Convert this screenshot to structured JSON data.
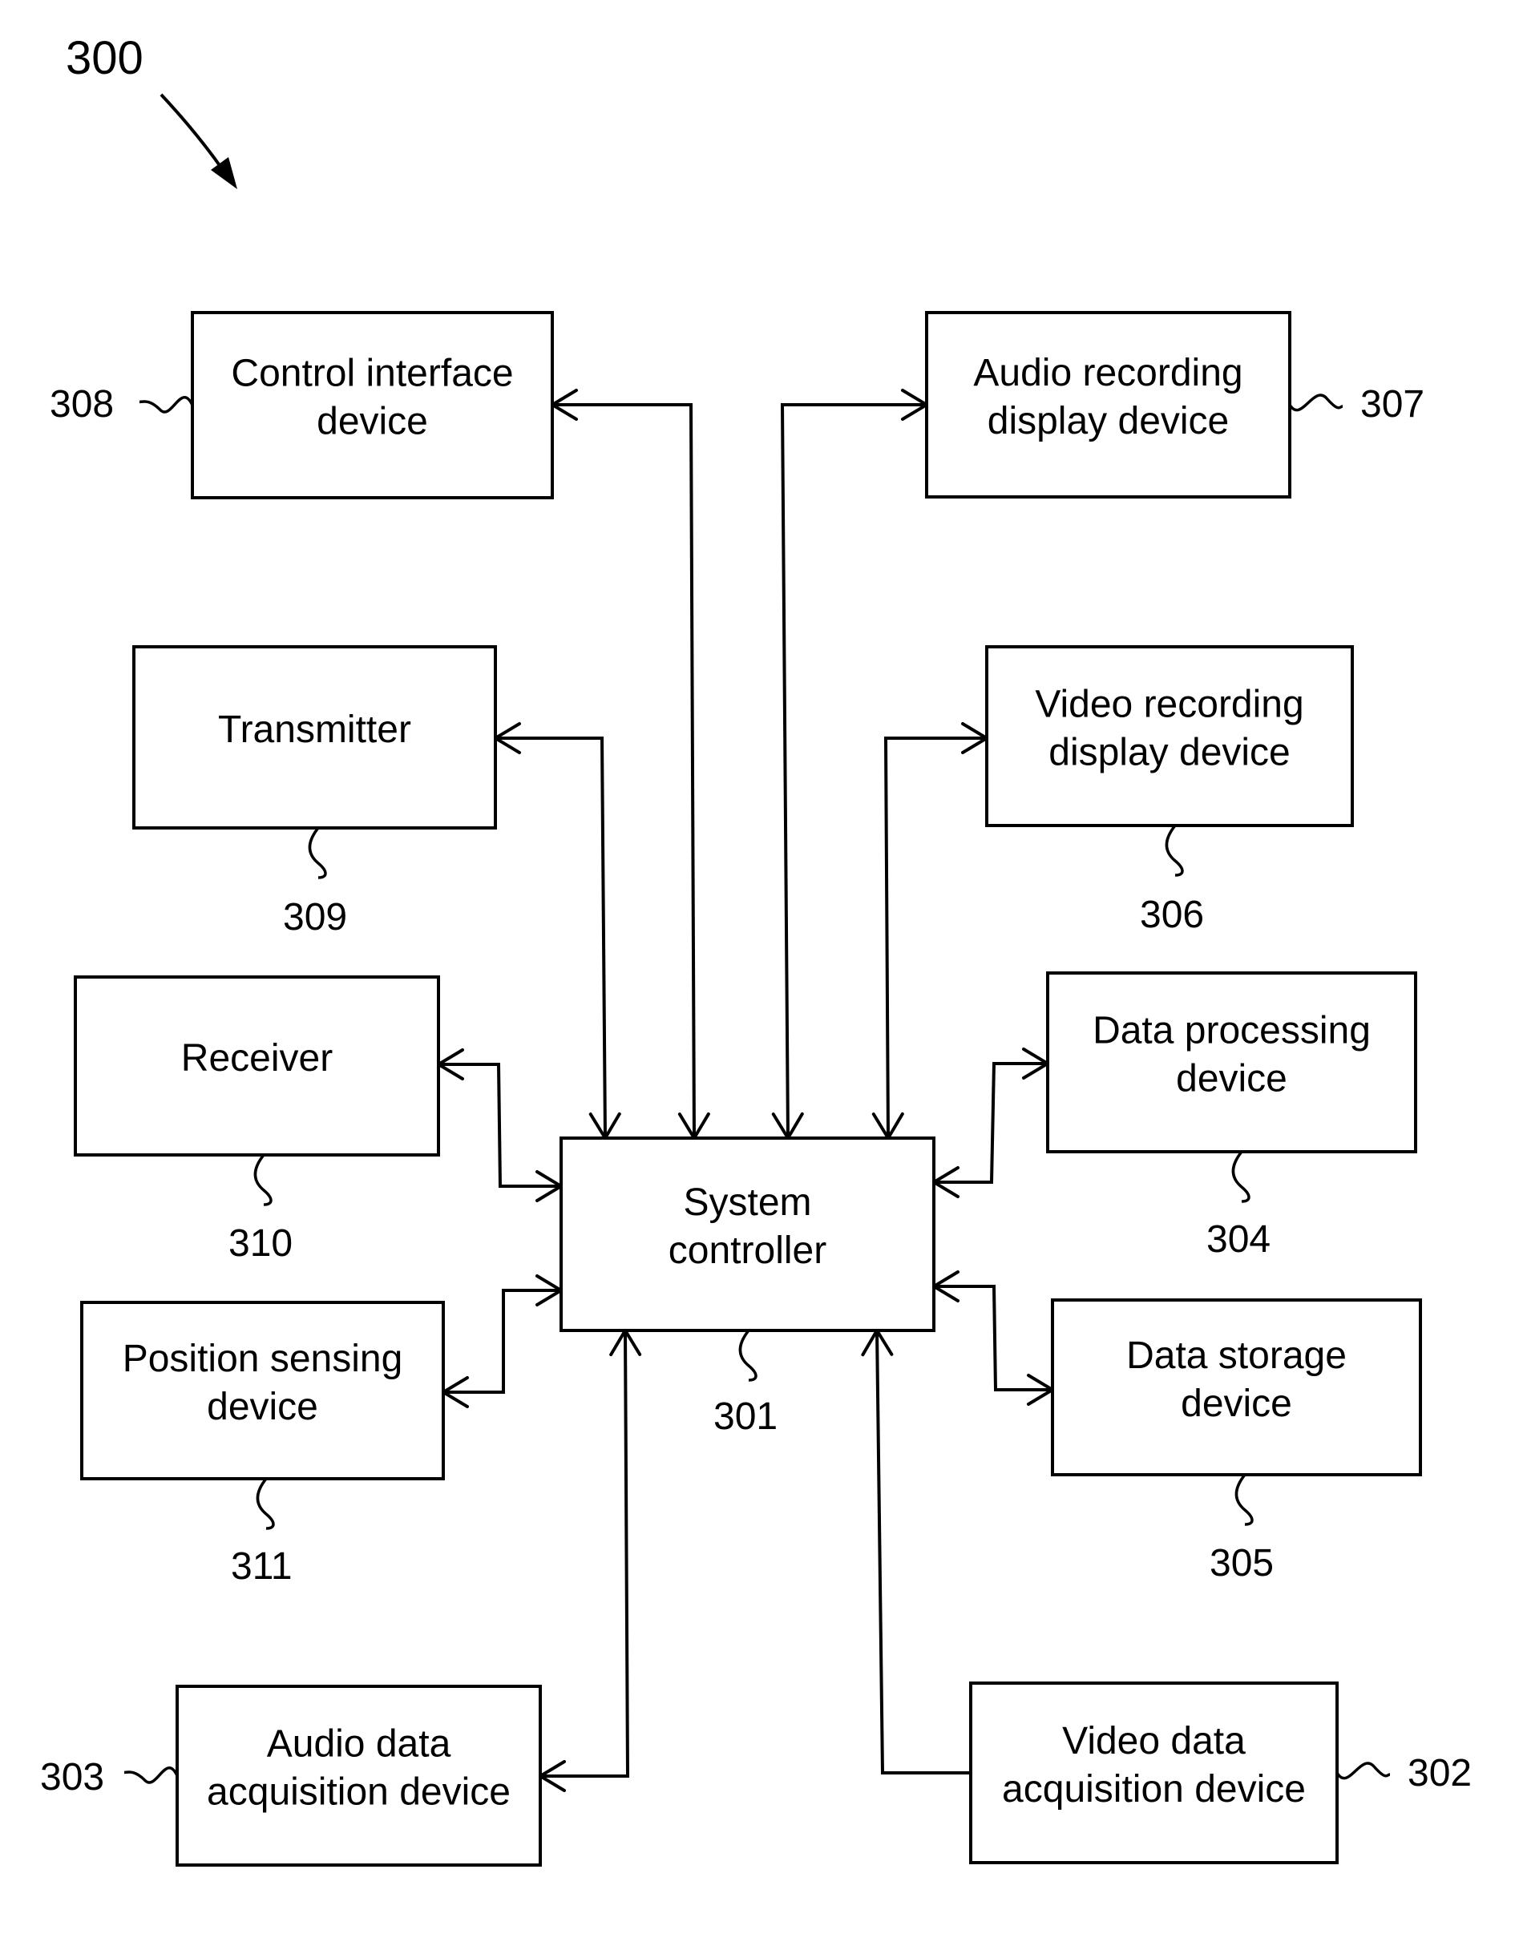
{
  "figure": {
    "number": "300"
  },
  "blocks": [
    {
      "id": "control-interface",
      "ref": "308",
      "lines": [
        "Control interface",
        "device"
      ]
    },
    {
      "id": "audio-recording-display",
      "ref": "307",
      "lines": [
        "Audio recording",
        "display device"
      ]
    },
    {
      "id": "transmitter",
      "ref": "309",
      "lines": [
        "Transmitter"
      ]
    },
    {
      "id": "video-recording-display",
      "ref": "306",
      "lines": [
        "Video recording",
        "display device"
      ]
    },
    {
      "id": "receiver",
      "ref": "310",
      "lines": [
        "Receiver"
      ]
    },
    {
      "id": "data-processing",
      "ref": "304",
      "lines": [
        "Data processing",
        "device"
      ]
    },
    {
      "id": "system-controller",
      "ref": "301",
      "lines": [
        "System",
        "controller"
      ]
    },
    {
      "id": "position-sensing",
      "ref": "311",
      "lines": [
        "Position sensing",
        "device"
      ]
    },
    {
      "id": "data-storage",
      "ref": "305",
      "lines": [
        "Data storage",
        "device"
      ]
    },
    {
      "id": "audio-data-acquisition",
      "ref": "303",
      "lines": [
        "Audio data",
        "acquisition device"
      ]
    },
    {
      "id": "video-data-acquisition",
      "ref": "302",
      "lines": [
        "Video data",
        "acquisition device"
      ]
    }
  ],
  "connections": [
    {
      "from": "system-controller",
      "to": "control-interface",
      "direction": "bidirectional"
    },
    {
      "from": "system-controller",
      "to": "audio-recording-display",
      "direction": "bidirectional"
    },
    {
      "from": "system-controller",
      "to": "transmitter",
      "direction": "bidirectional"
    },
    {
      "from": "system-controller",
      "to": "video-recording-display",
      "direction": "bidirectional"
    },
    {
      "from": "system-controller",
      "to": "receiver",
      "direction": "bidirectional"
    },
    {
      "from": "system-controller",
      "to": "data-processing",
      "direction": "bidirectional"
    },
    {
      "from": "system-controller",
      "to": "position-sensing",
      "direction": "bidirectional"
    },
    {
      "from": "system-controller",
      "to": "data-storage",
      "direction": "bidirectional"
    },
    {
      "from": "system-controller",
      "to": "audio-data-acquisition",
      "direction": "bidirectional"
    },
    {
      "from": "video-data-acquisition",
      "to": "system-controller",
      "direction": "unidirectional"
    }
  ]
}
